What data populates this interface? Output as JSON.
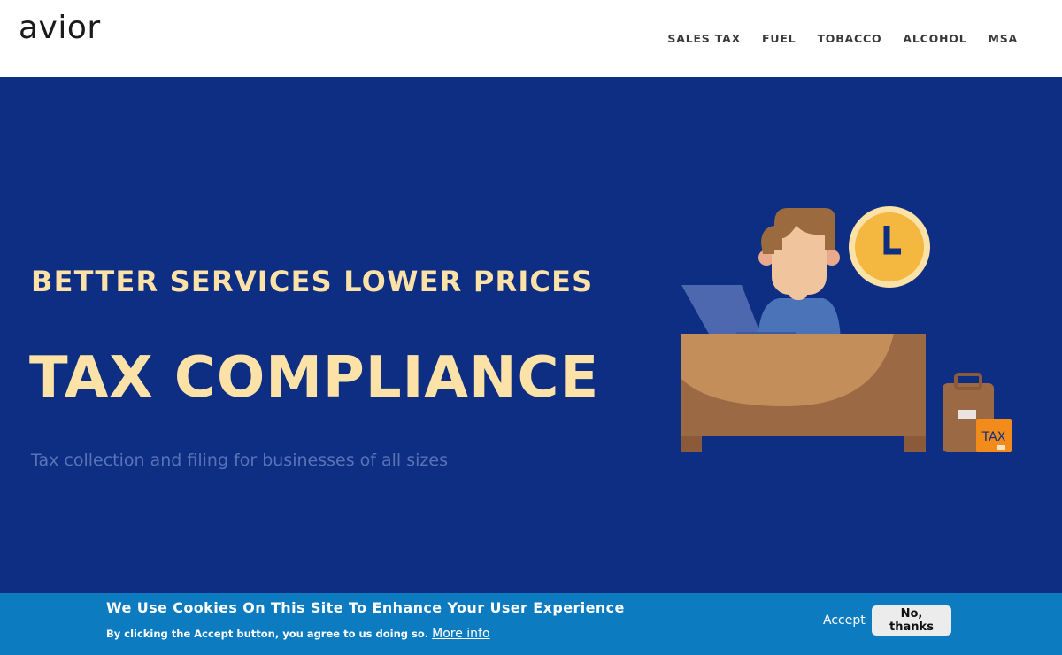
{
  "header": {
    "logo": "avior",
    "nav": [
      {
        "label": "SALES TAX"
      },
      {
        "label": "FUEL"
      },
      {
        "label": "TOBACCO"
      },
      {
        "label": "ALCOHOL"
      },
      {
        "label": "MSA"
      }
    ]
  },
  "hero": {
    "tagline": "BETTER SERVICES LOWER PRICES",
    "headline": "TAX COMPLIANCE",
    "subline": "Tax collection and filing for businesses of all sizes",
    "illustration": {
      "tax_tag": "TAX",
      "icons": [
        "person-at-desk-icon",
        "clock-icon",
        "laptop-icon",
        "briefcase-icon"
      ]
    }
  },
  "cookie": {
    "title": "We Use Cookies On This Site To Enhance Your User Experience",
    "text": "By clicking the Accept button, you agree to us doing so.",
    "more_info": "More info",
    "accept_label": "Accept",
    "decline_label": "No, thanks"
  },
  "colors": {
    "hero_bg": "#0d2e82",
    "accent_text": "#fde2a8",
    "cookie_bg": "#0c7bc0"
  }
}
